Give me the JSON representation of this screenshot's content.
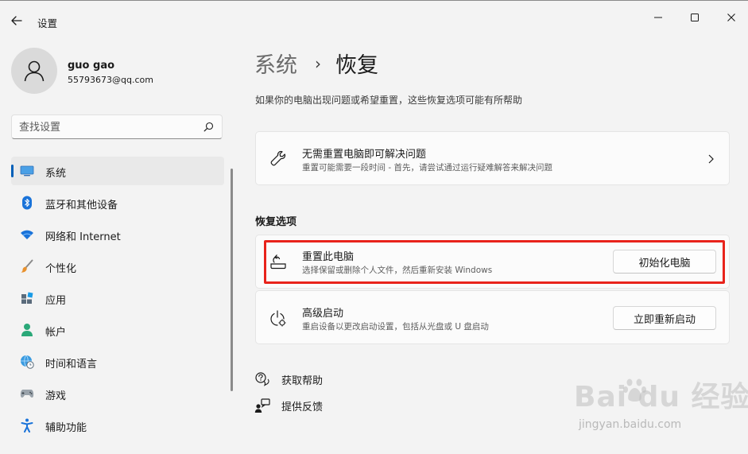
{
  "window": {
    "app_title": "设置"
  },
  "user": {
    "name": "guo gao",
    "email": "55793673@qq.com"
  },
  "search": {
    "placeholder": "查找设置"
  },
  "sidebar": {
    "items": [
      {
        "label": "系统",
        "icon": "system-icon",
        "active": true
      },
      {
        "label": "蓝牙和其他设备",
        "icon": "bluetooth-icon"
      },
      {
        "label": "网络和 Internet",
        "icon": "wifi-icon"
      },
      {
        "label": "个性化",
        "icon": "brush-icon"
      },
      {
        "label": "应用",
        "icon": "apps-icon"
      },
      {
        "label": "帐户",
        "icon": "account-icon"
      },
      {
        "label": "时间和语言",
        "icon": "globe-clock-icon"
      },
      {
        "label": "游戏",
        "icon": "gamepad-icon"
      },
      {
        "label": "辅助功能",
        "icon": "accessibility-icon"
      }
    ]
  },
  "breadcrumb": {
    "parent": "系统",
    "separator": "›",
    "current": "恢复"
  },
  "page": {
    "description": "如果你的电脑出现问题或希望重置，这些恢复选项可能有所帮助"
  },
  "troubleshoot_card": {
    "title": "无需重置电脑即可解决问题",
    "subtitle": "重置可能需要一段时间 - 首先，请尝试通过运行疑难解答来解决问题"
  },
  "recovery": {
    "section_title": "恢复选项",
    "reset": {
      "title": "重置此电脑",
      "subtitle": "选择保留或删除个人文件，然后重新安装 Windows",
      "button": "初始化电脑"
    },
    "advanced": {
      "title": "高级启动",
      "subtitle": "重启设备以更改启动设置，包括从光盘或 U 盘启动",
      "button": "立即重新启动"
    }
  },
  "links": {
    "help": "获取帮助",
    "feedback": "提供反馈"
  },
  "watermark": {
    "brand": "Bai  du 经验",
    "url": "jingyan.baidu.com"
  },
  "colors": {
    "accent": "#005fb8",
    "highlight_border": "#e8231b",
    "background": "#f3f3f3",
    "card": "#fbfbfb"
  }
}
